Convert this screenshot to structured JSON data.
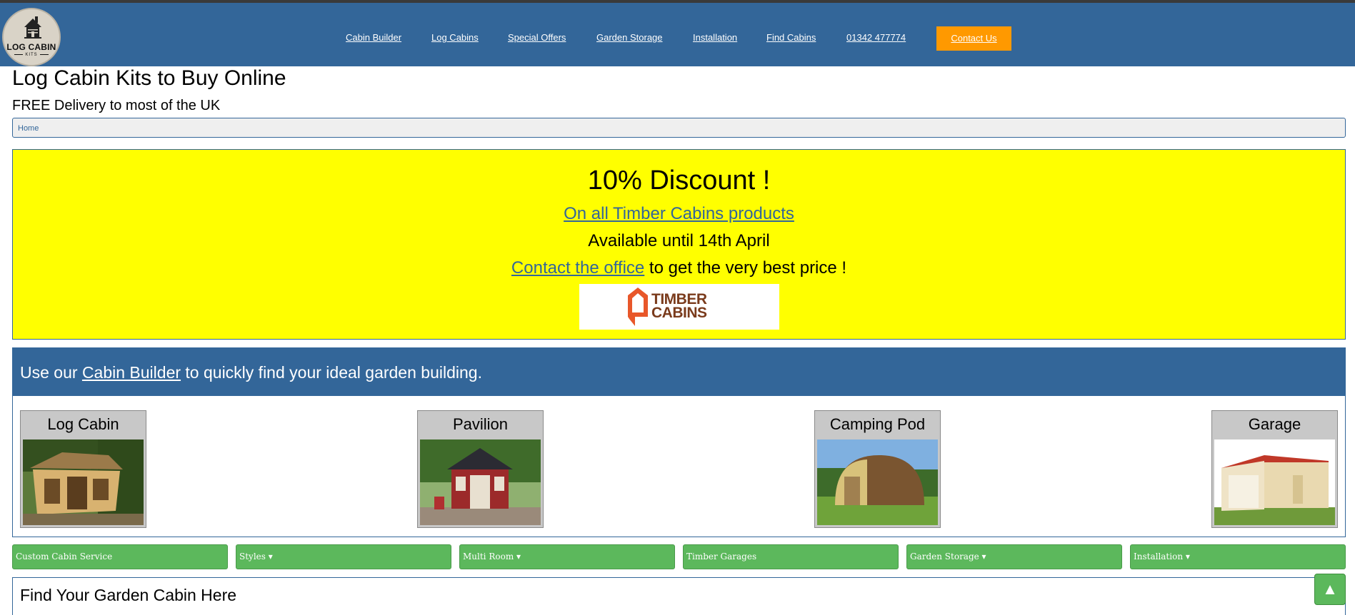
{
  "logo": {
    "line1": "LOG CABIN",
    "line2": "KITS",
    "icon": "cabin-house-icon"
  },
  "nav": {
    "items": [
      "Cabin Builder",
      "Log Cabins",
      "Special Offers",
      "Garden Storage",
      "Installation",
      "Find Cabins",
      "01342 477774"
    ],
    "contact_label": "Contact Us"
  },
  "page": {
    "title": "Log Cabin Kits to Buy Online",
    "subtitle": "FREE Delivery to most of the UK"
  },
  "breadcrumb": {
    "home": "Home"
  },
  "promo": {
    "heading": "10% Discount !",
    "link": "On all Timber Cabins products",
    "availability": "Available until 14th April",
    "contact_link": "Contact the office",
    "contact_rest": " to get the very best price !",
    "brand_line1": "TIMBER",
    "brand_line2": "CABINS"
  },
  "builder": {
    "text_before": "Use our ",
    "link": "Cabin Builder",
    "text_after": " to quickly find your ideal garden building.",
    "cards": [
      "Log Cabin",
      "Pavilion",
      "Camping Pod",
      "Garage"
    ]
  },
  "menu_buttons": [
    "Custom Cabin Service",
    "Styles ▾",
    "Multi Room ▾",
    "Timber Garages",
    "Garden Storage ▾",
    "Installation ▾"
  ],
  "find": {
    "title": "Find Your Garden Cabin Here"
  },
  "back_to_top": "▲",
  "colors": {
    "navbar": "#336699",
    "accent_orange": "#ff9900",
    "promo_yellow": "#ffff00",
    "button_green": "#5cb85c"
  }
}
